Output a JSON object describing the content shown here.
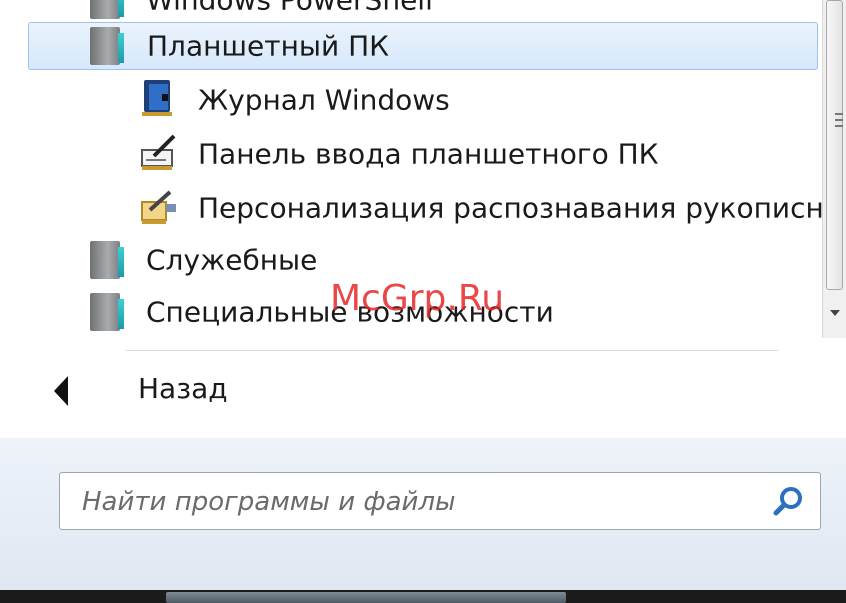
{
  "programs": {
    "items": [
      {
        "label": "Windows PowerShell",
        "icon": "folder-icon"
      },
      {
        "label": "Планшетный ПК",
        "icon": "folder-icon",
        "selected": true
      },
      {
        "label": "Журнал Windows",
        "icon": "windows-journal-icon"
      },
      {
        "label": "Панель ввода планшетного ПК",
        "icon": "tablet-input-panel-icon"
      },
      {
        "label": "Персонализация распознавания рукописного ввода",
        "icon": "handwriting-personalization-icon"
      },
      {
        "label": "Служебные",
        "icon": "folder-icon"
      },
      {
        "label": "Специальные возможности",
        "icon": "folder-icon"
      }
    ]
  },
  "nav": {
    "back_label": "Назад"
  },
  "search": {
    "placeholder": "Найти программы и файлы"
  },
  "watermark": "McGrp.Ru",
  "colors": {
    "selection_bg": "#d6e8fb",
    "selection_border": "#9fc3ea",
    "folder_edge": "#2bb8c0"
  }
}
